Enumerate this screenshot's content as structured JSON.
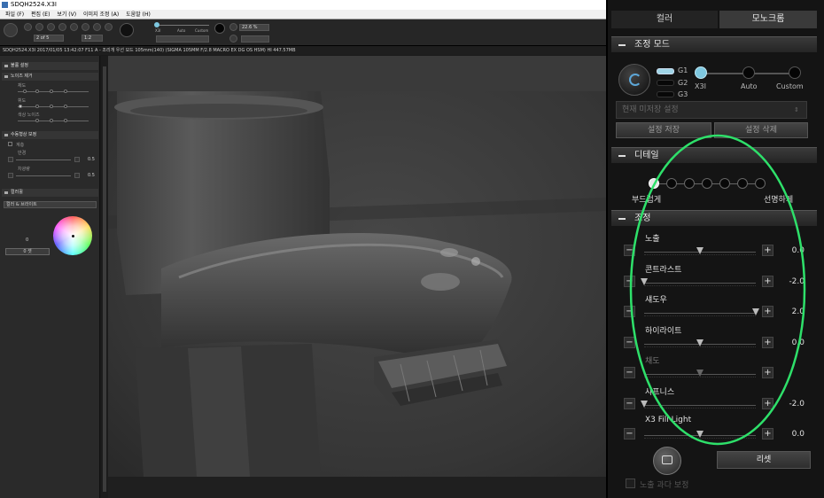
{
  "window": {
    "title": "SDQH2524.X3I"
  },
  "menu": [
    "파일 (F)",
    "편집 (E)",
    "보기 (V)",
    "이미지 조정 (A)",
    "도움말 (H)"
  ],
  "toolbar": {
    "page": "2 of 5",
    "ratio": "1:2",
    "zoom": "22.6 %",
    "mode_x3i": "X3I",
    "mode_auto": "Auto",
    "mode_custom": "Custom"
  },
  "info": "SDQH2524.X3I 2017/01/05 13:42:07 F11 A - 조리개 우선 모드 105mm(140) (SIGMA 105MM F/2.8 MACRO EX DG OS HSM) HI 447.57MB",
  "left_panel": {
    "sections": [
      "불륨 설정",
      "노이즈 제거",
      "수동형상 보정",
      "컬러휠"
    ],
    "noise_labels": [
      "채도",
      "휘도",
      "색상 노이즈"
    ],
    "manual_labels": [
      "계층",
      "반경",
      "차광량"
    ],
    "manual_values": [
      "0.5",
      "0.5"
    ],
    "color_select": "컬러 & 브라이트",
    "color_value": "0",
    "reset": "0 셋"
  },
  "tabs": {
    "color": "컬러",
    "mono": "모노크롬"
  },
  "mode": {
    "title": "조정 모드",
    "g_labels": [
      "G1",
      "G2",
      "G3"
    ],
    "points": [
      "X3I",
      "Auto",
      "Custom"
    ],
    "preset_placeholder": "현재 미저장 설정",
    "save": "설정 저장",
    "delete": "설정 삭제"
  },
  "detail": {
    "title": "디테일",
    "left": "부드럽게",
    "right": "선명하게",
    "level_index": 0,
    "levels": 7
  },
  "adjust": {
    "title": "조정",
    "sliders": [
      {
        "label": "노출",
        "value": "0.0",
        "pos": 0.5,
        "enabled": true
      },
      {
        "label": "콘트라스트",
        "value": "-2.0",
        "pos": 0.0,
        "enabled": true
      },
      {
        "label": "섀도우",
        "value": "2.0",
        "pos": 1.0,
        "enabled": true
      },
      {
        "label": "하이라이트",
        "value": "0.0",
        "pos": 0.5,
        "enabled": true
      },
      {
        "label": "채도",
        "value": "",
        "pos": 0.5,
        "enabled": false
      },
      {
        "label": "샤프니스",
        "value": "-2.0",
        "pos": 0.0,
        "enabled": true
      },
      {
        "label": "X3 Fill Light",
        "value": "0.0",
        "pos": 0.5,
        "enabled": true
      }
    ],
    "reset": "리셋",
    "overexposure": "노출 과다 보정"
  },
  "colors": {
    "annotation": "#2ee06a",
    "mode_accent": "#7ec8e0"
  }
}
